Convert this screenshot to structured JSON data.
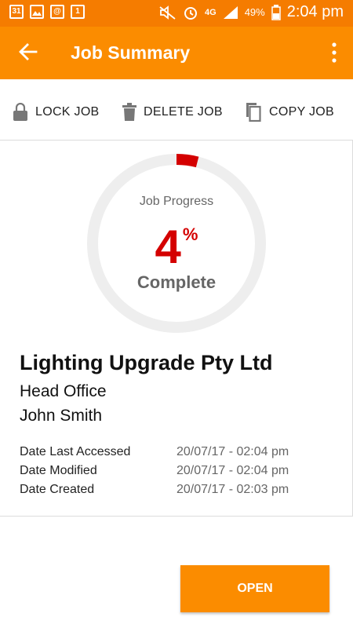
{
  "status_bar": {
    "left_icons": [
      "calendar-icon",
      "gallery-icon",
      "email-icon",
      "calendar-date-icon"
    ],
    "calendar_day": "31",
    "calendar_date": "1",
    "network": "4G",
    "battery": "49%",
    "time": "2:04 pm"
  },
  "app_bar": {
    "title": "Job Summary",
    "back_icon": "arrow-left-icon",
    "more_icon": "more-vertical-icon"
  },
  "toolbar": {
    "lock_label": "LOCK JOB",
    "delete_label": "DELETE JOB",
    "copy_label": "COPY JOB"
  },
  "progress": {
    "label": "Job Progress",
    "value": "4",
    "unit": "%",
    "fraction": 0.04,
    "status": "Complete"
  },
  "job": {
    "company": "Lighting Upgrade Pty Ltd",
    "site": "Head Office",
    "contact": "John Smith",
    "meta": [
      {
        "label": "Date Last Accessed",
        "value": "20/07/17 - 02:04 pm"
      },
      {
        "label": "Date Modified",
        "value": "20/07/17 - 02:04 pm"
      },
      {
        "label": "Date Created",
        "value": "20/07/17 - 02:03 pm"
      }
    ]
  },
  "actions": {
    "open_label": "OPEN"
  },
  "colors": {
    "accent": "#fb8c00",
    "status_bar": "#f57c00",
    "progress": "#d40000",
    "track": "#eeeeee"
  }
}
